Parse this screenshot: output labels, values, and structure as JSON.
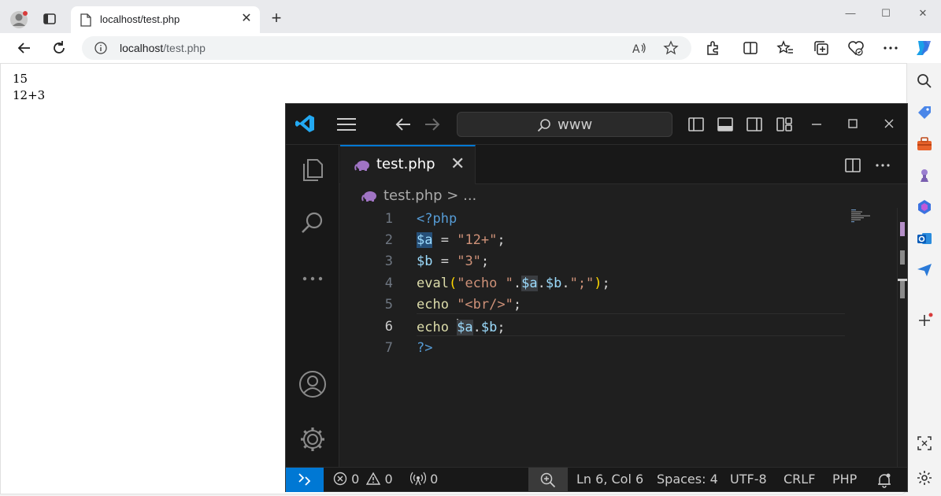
{
  "browser": {
    "tab": {
      "title": "localhost/test.php"
    },
    "address": {
      "host": "localhost",
      "path": "/test.php"
    }
  },
  "page": {
    "lines": [
      "15",
      "12+3"
    ]
  },
  "vscode": {
    "search_text": "www",
    "tab": {
      "name": "test.php"
    },
    "breadcrumb": {
      "file": "test.php",
      "rest": "> ..."
    },
    "line_numbers": [
      "1",
      "2",
      "3",
      "4",
      "5",
      "6",
      "7"
    ],
    "code": {
      "l1": "<?php",
      "l2_var": "$a",
      "l2_eq": " = ",
      "l2_str": "\"12+\"",
      "l2_end": ";",
      "l3_var": "$b",
      "l3_eq": " = ",
      "l3_str": "\"3\"",
      "l3_end": ";",
      "l4_fn": "eval",
      "l4_open": "(",
      "l4_str1": "\"echo \"",
      "l4_dot1": ".",
      "l4_var1": "$a",
      "l4_dot2": ".",
      "l4_var2": "$b",
      "l4_dot3": ".",
      "l4_str2": "\";\"",
      "l4_close": ")",
      "l4_end": ";",
      "l5_kw": "echo",
      "l5_str": " \"<br/>\"",
      "l5_end": ";",
      "l6_kw": "echo ",
      "l6_var1": "$a",
      "l6_dot": ".",
      "l6_var2": "$b",
      "l6_end": ";",
      "l7": "?>"
    },
    "status": {
      "errors": "0",
      "warnings": "0",
      "ports": "0",
      "position": "Ln 6, Col 6",
      "spaces": "Spaces: 4",
      "encoding": "UTF-8",
      "eol": "CRLF",
      "language": "PHP"
    }
  },
  "colors": {
    "vscode_accent": "#0078d4",
    "php_icon": "#a074c4"
  }
}
